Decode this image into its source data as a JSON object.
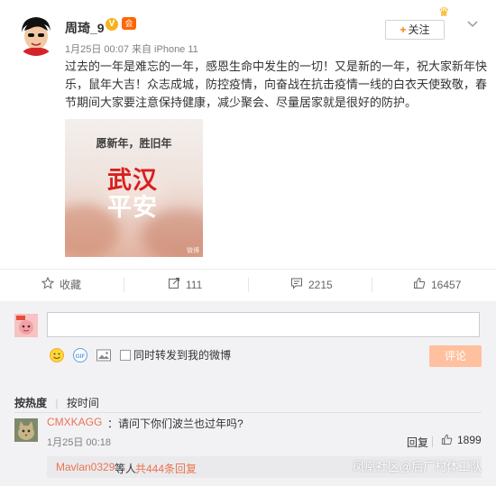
{
  "post": {
    "author": "周琦_9",
    "vbadge": "V",
    "lvbadge": "会",
    "meta": "1月25日 00:07 来自 iPhone 11",
    "follow_label": "关注",
    "follow_plus": "+",
    "text": "过去的一年是难忘的一年，感恩生命中发生的一切！又是新的一年，祝大家新年快乐，鼠年大吉！众志成城，防控疫情，向奋战在抗击疫情一线的白衣天使致敬，春节期间大家要注意保持健康，减少聚会、尽量居家就是很好的防护。",
    "image": {
      "line1": "愿新年，胜旧年",
      "line2": "武汉",
      "line3": "平安",
      "watermark": "微博"
    }
  },
  "actions": {
    "favorite": "收藏",
    "repost": "111",
    "comment": "2215",
    "like": "16457"
  },
  "composer": {
    "placeholder": "",
    "repost_label": "同时转发到我的微博",
    "submit_label": "评论"
  },
  "sort": {
    "hot": "按热度",
    "time": "按时间"
  },
  "comment": {
    "user": "CMXKAGG",
    "text": "：请问下你们波兰也过年吗?",
    "time": "1月25日 00:18",
    "reply_label": "回复",
    "likes": "1899"
  },
  "sub_reply": {
    "user": "Mavlan0329",
    "mid": "等人",
    "count": "共444条回复"
  },
  "watermark": "凤凰社区@后厂村体工队",
  "colors": {
    "accent": "#ff8200",
    "link": "#eb7350",
    "submit_disabled": "#ffc09f",
    "background": "#f2f2f5"
  }
}
